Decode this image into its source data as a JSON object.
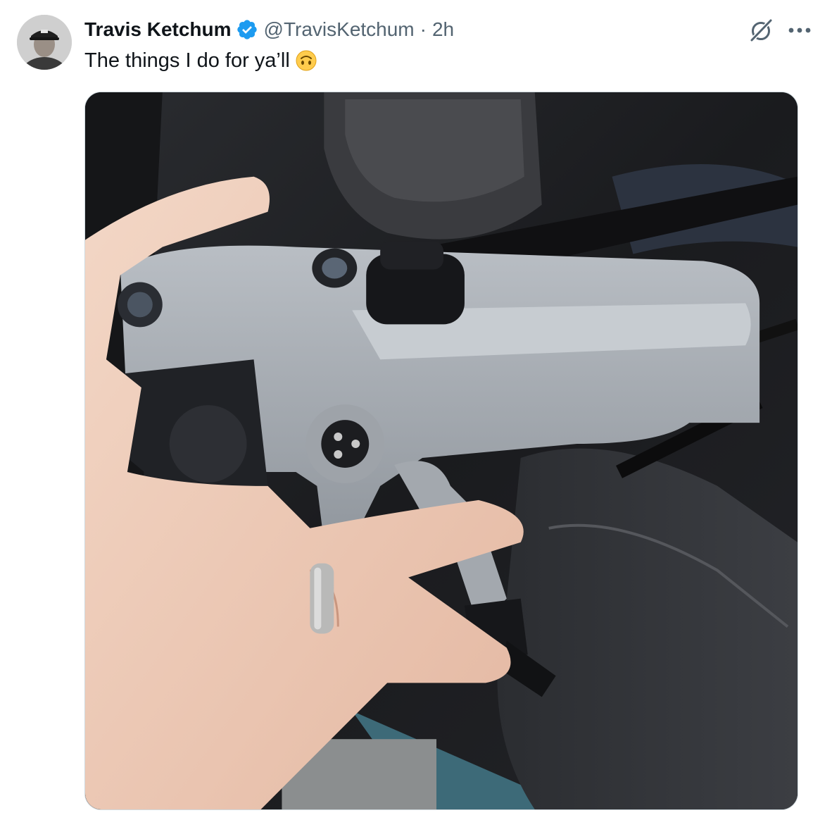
{
  "tweet": {
    "author": {
      "display_name": "Travis Ketchum",
      "handle": "@TravisKetchum",
      "verified_icon": "verified-badge-icon",
      "avatar_icon": "avatar"
    },
    "separator": "·",
    "time": "2h",
    "text": "The things I do for ya’ll",
    "emoji": "upside-down-face",
    "actions": {
      "grok": "grok-icon",
      "more": "more-options-icon"
    },
    "colors": {
      "text_primary": "#0f1419",
      "text_secondary": "#536471",
      "verified_blue": "#1d9bf0",
      "border": "#cfd9de"
    }
  }
}
